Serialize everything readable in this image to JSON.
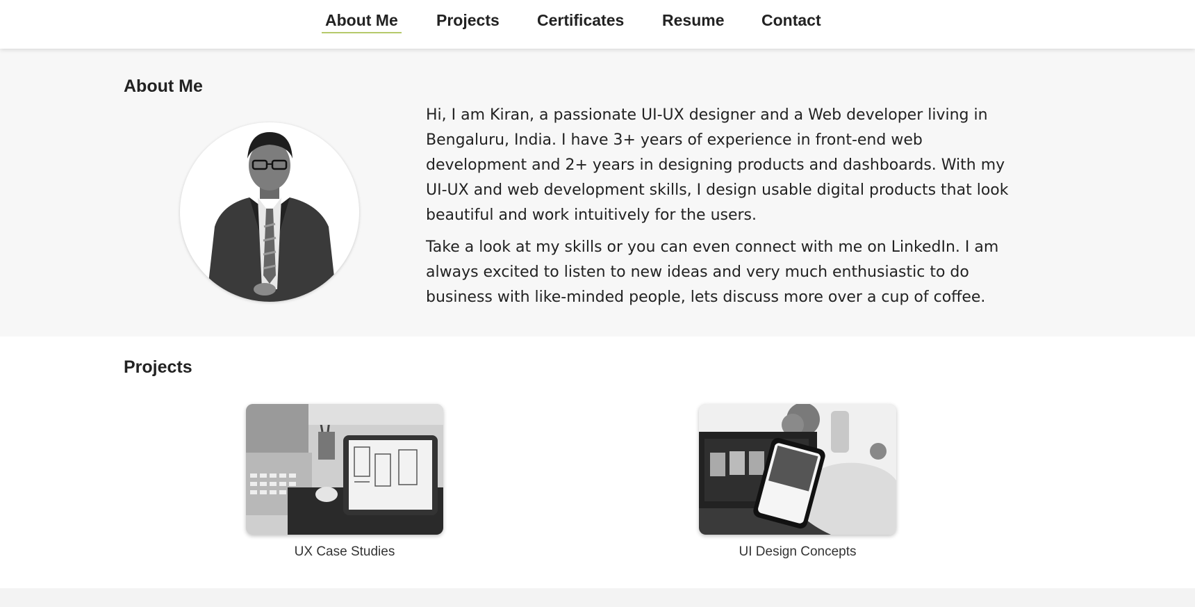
{
  "nav": {
    "items": [
      {
        "label": "About Me",
        "active": true
      },
      {
        "label": "Projects"
      },
      {
        "label": "Certificates"
      },
      {
        "label": "Resume"
      },
      {
        "label": "Contact"
      }
    ]
  },
  "about": {
    "title": "About Me",
    "paragraphs": [
      "Hi, I am Kiran, a passionate UI-UX designer and a Web developer living in Bengaluru, India. I have 3+ years of experience in front-end web development and 2+ years in designing products and dashboards. With my UI-UX and web development skills, I design usable digital products that look beautiful and work intuitively for the users.",
      "Take a look at my skills or you can even connect with me on LinkedIn. I am always excited to listen to new ideas and very much enthusiastic to do business with like-minded people, lets discuss more over a cup of coffee."
    ]
  },
  "projects": {
    "title": "Projects",
    "cards": [
      {
        "label": "UX Case Studies"
      },
      {
        "label": "UI Design Concepts"
      }
    ]
  },
  "colors": {
    "active_underline": "#b5c96a",
    "section_bg": "#f7f7f7"
  }
}
